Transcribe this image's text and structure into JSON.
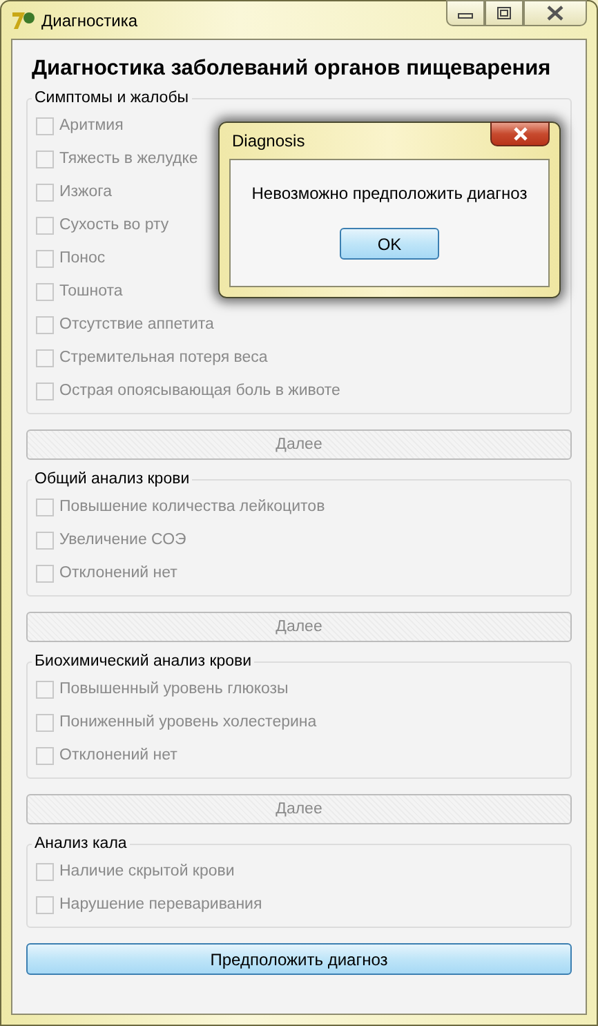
{
  "window": {
    "title": "Диагностика"
  },
  "heading": "Диагностика заболеваний органов пищеварения",
  "sections": [
    {
      "title": "Симптомы и жалобы",
      "items": [
        {
          "label": "Аритмия",
          "checked": false,
          "disabled": true
        },
        {
          "label": "Тяжесть в желудке",
          "checked": false,
          "disabled": true
        },
        {
          "label": "Изжога",
          "checked": false,
          "disabled": true
        },
        {
          "label": "Сухость во рту",
          "checked": false,
          "disabled": true
        },
        {
          "label": "Понос",
          "checked": false,
          "disabled": true
        },
        {
          "label": "Тошнота",
          "checked": false,
          "disabled": true
        },
        {
          "label": "Отсутствие аппетита",
          "checked": false,
          "disabled": true
        },
        {
          "label": "Стремительная потеря веса",
          "checked": false,
          "disabled": true
        },
        {
          "label": "Острая опоясывающая боль в животе",
          "checked": false,
          "disabled": true
        }
      ],
      "next_button": {
        "label": "Далее",
        "disabled": true
      }
    },
    {
      "title": "Общий анализ крови",
      "items": [
        {
          "label": "Повышение количества лейкоцитов",
          "checked": false,
          "disabled": true
        },
        {
          "label": "Увеличение СОЭ",
          "checked": false,
          "disabled": true
        },
        {
          "label": "Отклонений нет",
          "checked": false,
          "disabled": true
        }
      ],
      "next_button": {
        "label": "Далее",
        "disabled": true
      }
    },
    {
      "title": "Биохимический анализ крови",
      "items": [
        {
          "label": "Повышенный уровень глюкозы",
          "checked": false,
          "disabled": true
        },
        {
          "label": "Пониженный уровень холестерина",
          "checked": false,
          "disabled": true
        },
        {
          "label": "Отклонений нет",
          "checked": false,
          "disabled": true
        }
      ],
      "next_button": {
        "label": "Далее",
        "disabled": true
      }
    },
    {
      "title": "Анализ кала",
      "items": [
        {
          "label": "Наличие скрытой крови",
          "checked": false,
          "disabled": true
        },
        {
          "label": "Нарушение переваривания",
          "checked": false,
          "disabled": true
        }
      ]
    }
  ],
  "submit_button": {
    "label": "Предположить диагноз",
    "disabled": false
  },
  "dialog": {
    "title": "Diagnosis",
    "message": "Невозможно предположить диагноз",
    "button": "OK"
  }
}
